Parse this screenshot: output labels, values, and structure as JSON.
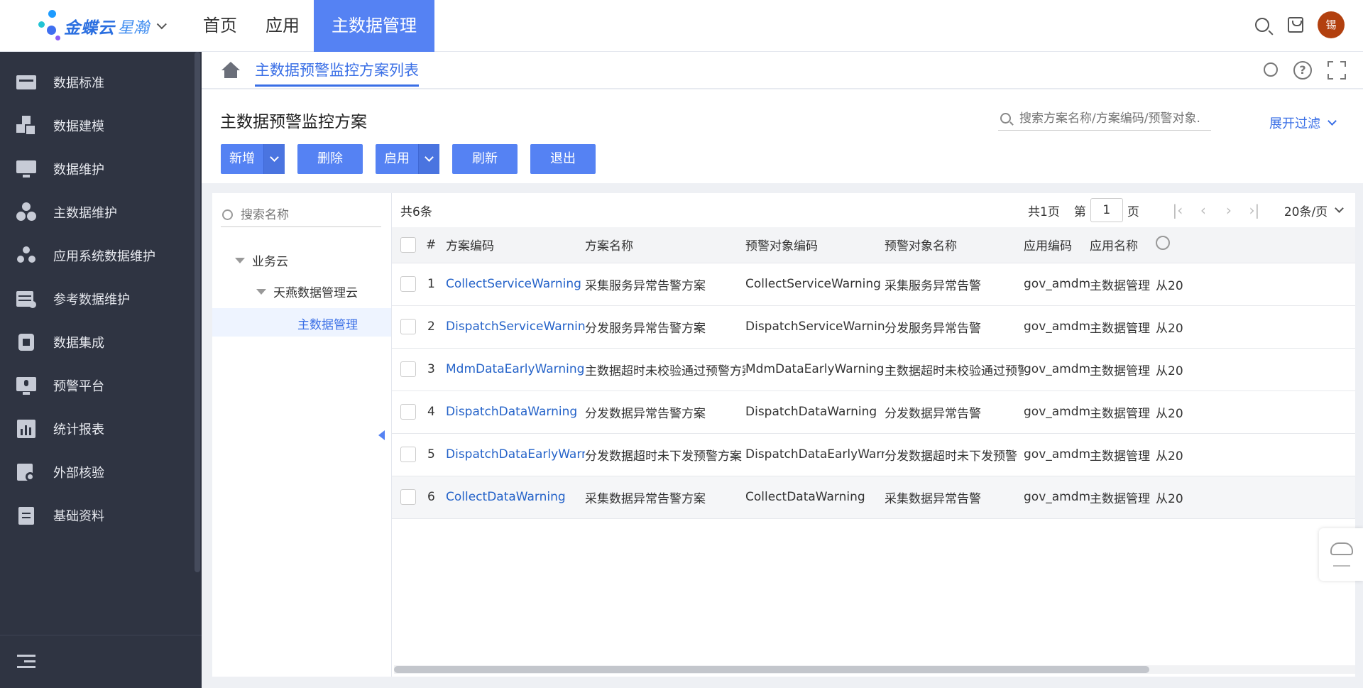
{
  "app": {
    "brand": "金蝶云",
    "brand_sub": "星瀚",
    "nav": [
      {
        "label": "首页",
        "active": false
      },
      {
        "label": "应用",
        "active": false
      },
      {
        "label": "主数据管理",
        "active": true
      }
    ],
    "user_avatar_text": "锡",
    "icons": [
      "search-icon",
      "cart-icon",
      "avatar"
    ]
  },
  "sidebar": {
    "items": [
      {
        "label": "数据标准",
        "icon": "chart-board-icon"
      },
      {
        "label": "数据建模",
        "icon": "blocks-icon"
      },
      {
        "label": "数据维护",
        "icon": "monitor-icon"
      },
      {
        "label": "主数据维护",
        "icon": "cluster-icon"
      },
      {
        "label": "应用系统数据维护",
        "icon": "nodes-icon"
      },
      {
        "label": "参考数据维护",
        "icon": "table-gear-icon"
      },
      {
        "label": "数据集成",
        "icon": "cube-icon"
      },
      {
        "label": "预警平台",
        "icon": "alert-screen-icon"
      },
      {
        "label": "统计报表",
        "icon": "report-icon"
      },
      {
        "label": "外部核验",
        "icon": "clipboard-search-icon"
      },
      {
        "label": "基础资料",
        "icon": "clipboard-list-icon"
      }
    ]
  },
  "breadcrumb": {
    "tab": "主数据预警监控方案列表"
  },
  "page": {
    "title": "主数据预警监控方案",
    "search_placeholder": "搜索方案名称/方案编码/预警对象.",
    "filter_toggle": "展开过滤",
    "buttons": {
      "add": "新增",
      "delete": "删除",
      "enable": "启用",
      "refresh": "刷新",
      "exit": "退出"
    }
  },
  "tree": {
    "search_placeholder": "搜索名称",
    "nodes": {
      "root": "业务云",
      "child": "天燕数据管理云",
      "leaf": "主数据管理"
    }
  },
  "grid": {
    "total": "共6条",
    "pager": {
      "total_pages": "共1页",
      "page_prefix": "第",
      "page": "1",
      "page_suffix": "页",
      "page_size": "20条/页"
    },
    "columns": {
      "index": "#",
      "code": "方案编码",
      "name": "方案名称",
      "obj_code": "预警对象编码",
      "obj_name": "预警对象名称",
      "app_code": "应用编码",
      "app_name": "应用名称"
    },
    "rows": [
      {
        "index": "1",
        "code": "CollectServiceWarning",
        "name": "采集服务异常告警方案",
        "obj_code": "CollectServiceWarning",
        "obj_name": "采集服务异常告警",
        "app_code": "gov_amdm",
        "app_name": "主数据管理",
        "extra": "从20"
      },
      {
        "index": "2",
        "code": "DispatchServiceWarning",
        "name": "分发服务异常告警方案",
        "obj_code": "DispatchServiceWarning",
        "obj_name": "分发服务异常告警",
        "app_code": "gov_amdm",
        "app_name": "主数据管理",
        "extra": "从20"
      },
      {
        "index": "3",
        "code": "MdmDataEarlyWarning",
        "name": "主数据超时未校验通过预警方案",
        "obj_code": "MdmDataEarlyWarning",
        "obj_name": "主数据超时未校验通过预警",
        "app_code": "gov_amdm",
        "app_name": "主数据管理",
        "extra": "从20"
      },
      {
        "index": "4",
        "code": "DispatchDataWarning",
        "name": "分发数据异常告警方案",
        "obj_code": "DispatchDataWarning",
        "obj_name": "分发数据异常告警",
        "app_code": "gov_amdm",
        "app_name": "主数据管理",
        "extra": "从20"
      },
      {
        "index": "5",
        "code": "DispatchDataEarlyWarning",
        "name": "分发数据超时未下发预警方案",
        "obj_code": "DispatchDataEarlyWarning",
        "obj_name": "分发数据超时未下发预警",
        "app_code": "gov_amdm",
        "app_name": "主数据管理",
        "extra": "从20"
      },
      {
        "index": "6",
        "code": "CollectDataWarning",
        "name": "采集数据异常告警方案",
        "obj_code": "CollectDataWarning",
        "obj_name": "采集数据异常告警",
        "app_code": "gov_amdm",
        "app_name": "主数据管理",
        "extra": "从20"
      }
    ]
  },
  "colors": {
    "accent": "#5582f3",
    "link": "#2563c9",
    "sidebar_bg": "#2f3442",
    "avatar_bg": "#b2400f"
  }
}
